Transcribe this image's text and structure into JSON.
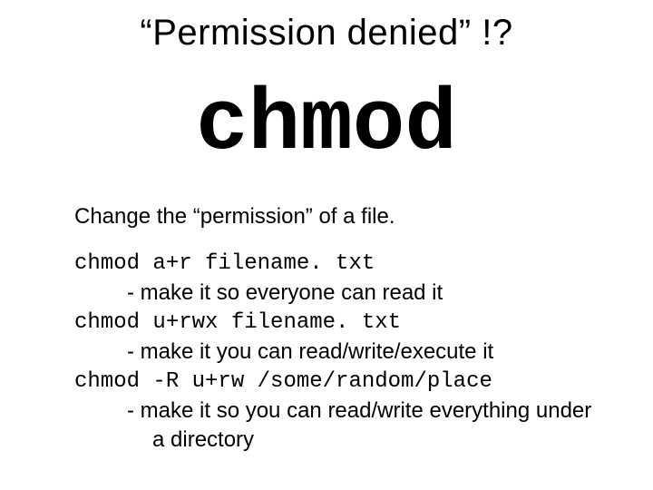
{
  "title": "“Permission denied” !?",
  "command": "chmod",
  "description": "Change the “permission” of a file.",
  "examples": [
    {
      "cmd": "chmod a+r filename. txt",
      "explain": "make it so everyone can read it"
    },
    {
      "cmd": "chmod u+rwx filename. txt",
      "explain": "make it you can read/write/execute it"
    },
    {
      "cmd": "chmod -R u+rw /some/random/place",
      "explain": "make it so you can read/write everything under",
      "explain2": "a directory"
    }
  ]
}
